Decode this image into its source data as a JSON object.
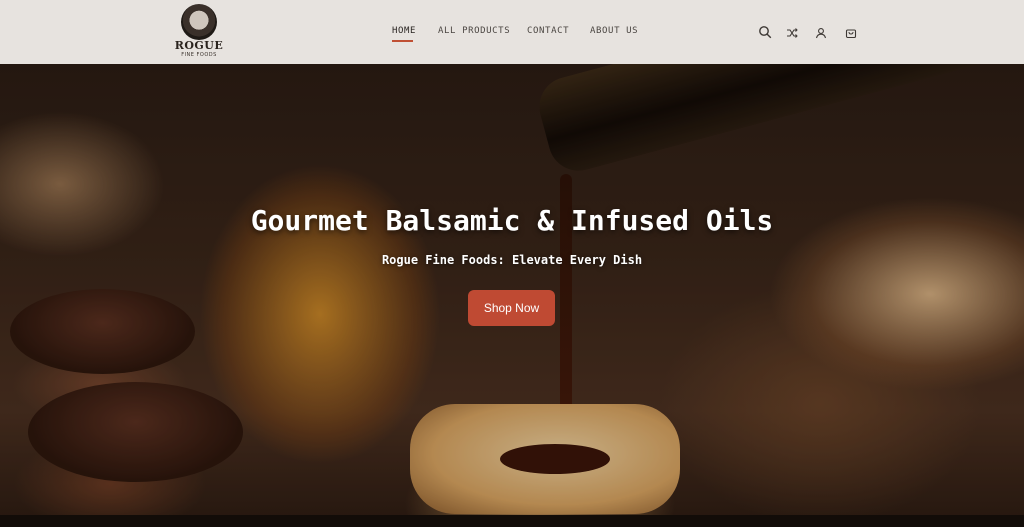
{
  "brand": {
    "name": "ROGUE",
    "tagline": "FINE FOODS"
  },
  "nav": {
    "items": [
      {
        "label": "HOME",
        "active": true
      },
      {
        "label": "ALL PRODUCTS",
        "active": false
      },
      {
        "label": "CONTACT",
        "active": false
      },
      {
        "label": "ABOUT US",
        "active": false
      }
    ]
  },
  "header_icons": [
    "search-icon",
    "shuffle-icon",
    "user-icon",
    "cart-icon"
  ],
  "hero": {
    "title": "Gourmet Balsamic & Infused Oils",
    "subtitle": "Rogue Fine Foods: Elevate Every Dish",
    "cta_label": "Shop Now"
  },
  "colors": {
    "accent": "#bf4a33",
    "header_bg": "#f6f3f0",
    "nav_text": "#4b4642"
  }
}
